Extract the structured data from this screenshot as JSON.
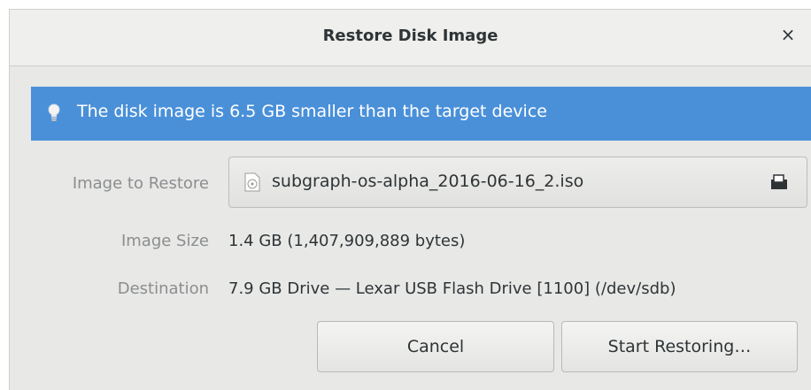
{
  "window": {
    "title": "Restore Disk Image",
    "close_glyph": "×"
  },
  "info": {
    "message": "The disk image is 6.5 GB smaller than the target device",
    "icon": "lightbulb-icon",
    "color": "#4a90d9"
  },
  "form": {
    "image_label": "Image to Restore",
    "image_file": "subgraph-os-alpha_2016-06-16_2.iso",
    "size_label": "Image Size",
    "size_value": "1.4 GB (1,407,909,889 bytes)",
    "destination_label": "Destination",
    "destination_value": "7.9 GB Drive — Lexar USB Flash Drive [1100] (/dev/sdb)"
  },
  "buttons": {
    "cancel": "Cancel",
    "start": "Start Restoring…"
  }
}
